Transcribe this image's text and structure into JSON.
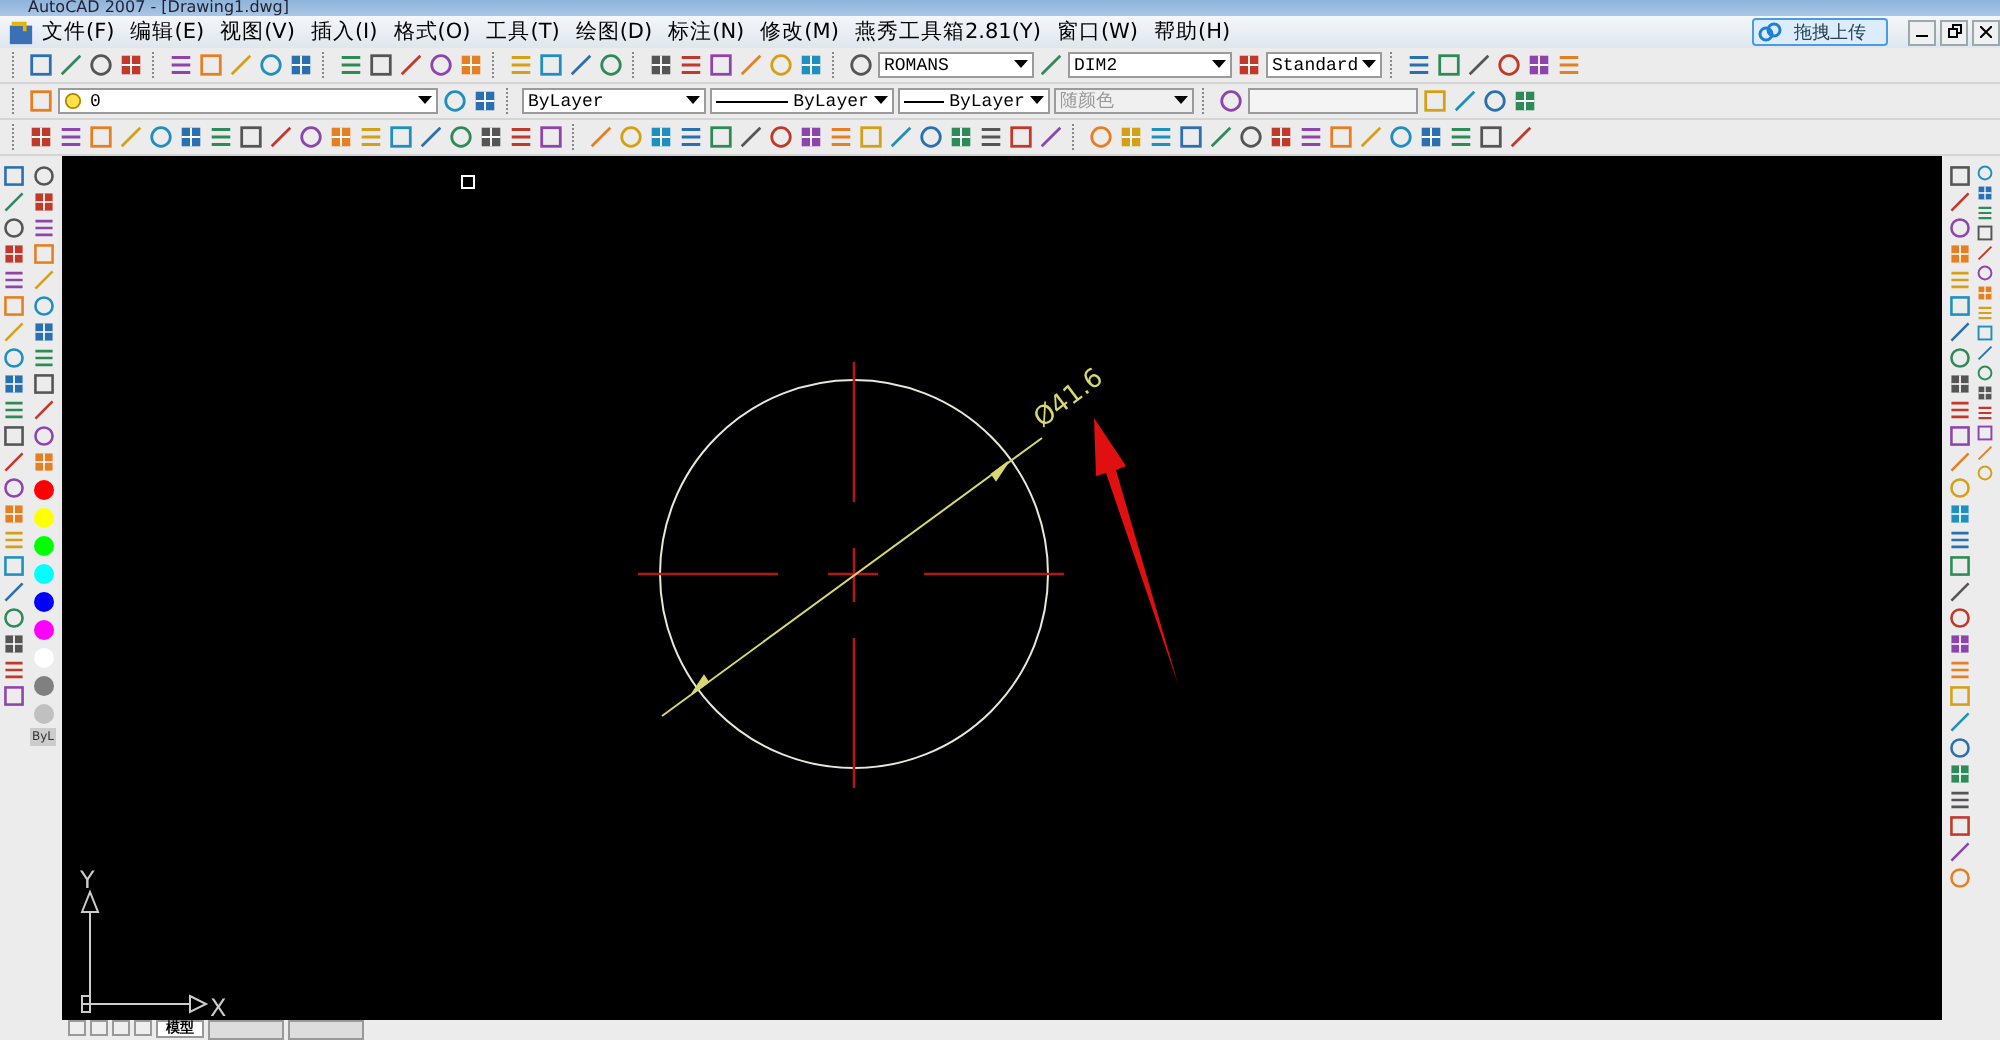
{
  "title": "AutoCAD 2007 - [Drawing1.dwg]",
  "menu": [
    {
      "label": "文件(F)"
    },
    {
      "label": "编辑(E)"
    },
    {
      "label": "视图(V)"
    },
    {
      "label": "插入(I)"
    },
    {
      "label": "格式(O)"
    },
    {
      "label": "工具(T)"
    },
    {
      "label": "绘图(D)"
    },
    {
      "label": "标注(N)"
    },
    {
      "label": "修改(M)"
    },
    {
      "label": "燕秀工具箱2.81(Y)"
    },
    {
      "label": "窗口(W)"
    },
    {
      "label": "帮助(H)"
    }
  ],
  "upload_button": "拖拽上传",
  "styles": {
    "text_style": "ROMANS",
    "dim_style": "DIM2",
    "table_style": "Standard"
  },
  "properties": {
    "layer": "0",
    "color_control": "ByLayer",
    "linetype": "ByLayer",
    "lineweight": "ByLayer",
    "plot_style": {
      "value": "随颜色",
      "disabled": true
    }
  },
  "palette": [
    {
      "color": "#ff0000"
    },
    {
      "color": "#ffff00"
    },
    {
      "color": "#00ff00"
    },
    {
      "color": "#00ffff"
    },
    {
      "color": "#0000ff"
    },
    {
      "color": "#ff00ff"
    },
    {
      "color": "#ffffff"
    },
    {
      "color": "#808080"
    },
    {
      "color": "#c0c0c0"
    }
  ],
  "palette_bylayer": "ByL",
  "drawing": {
    "dimension": "Ø41.6",
    "x_axis": "X",
    "y_axis": "Y"
  },
  "layout_tabs": [
    {
      "label": "模型",
      "selected": true
    }
  ]
}
